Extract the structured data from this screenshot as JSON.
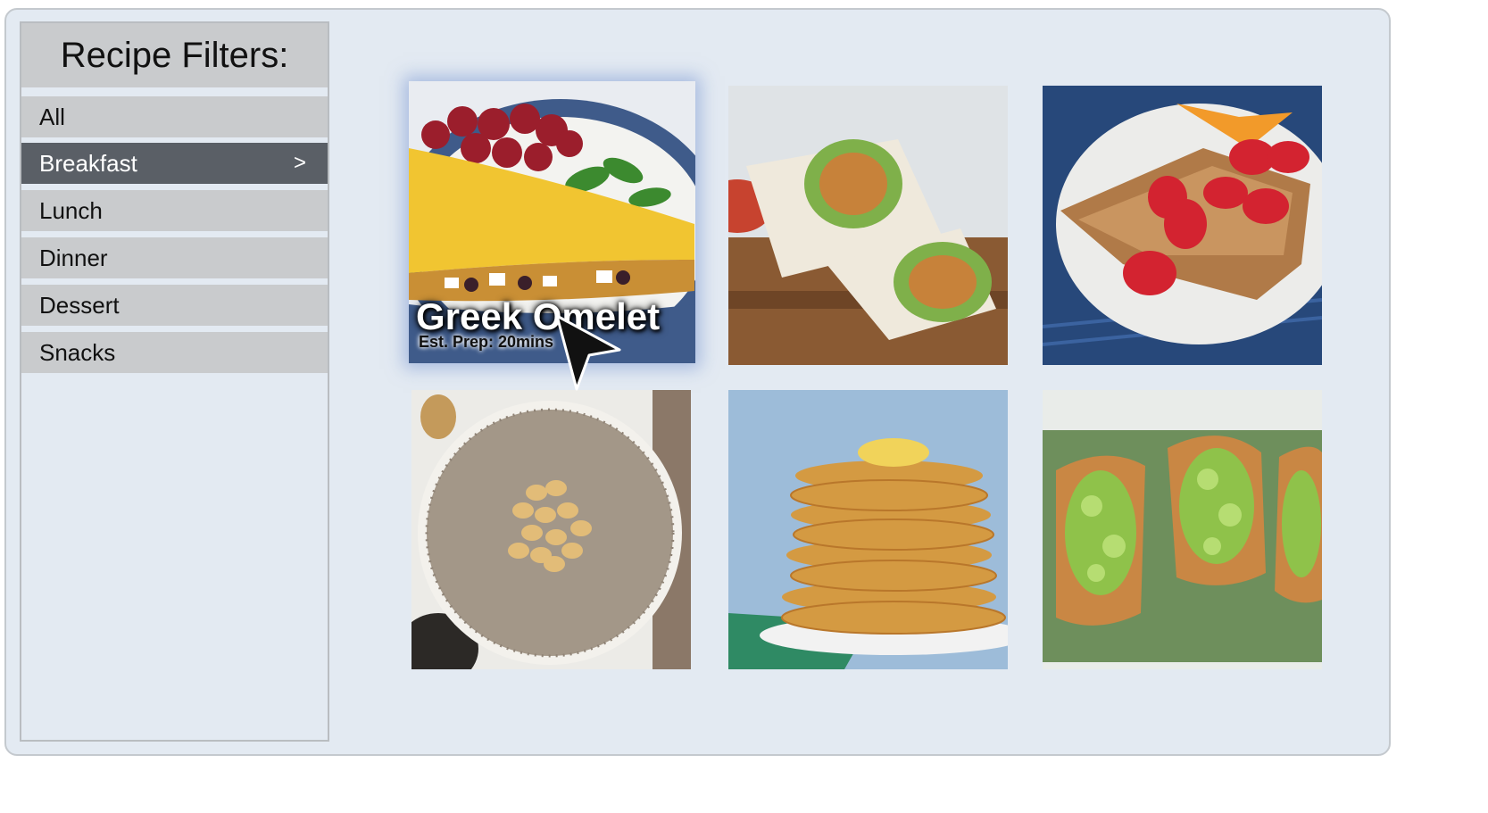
{
  "sidebar": {
    "title": "Recipe Filters:",
    "items": [
      {
        "label": "All",
        "active": false
      },
      {
        "label": "Breakfast",
        "active": true,
        "arrow": ">"
      },
      {
        "label": "Lunch",
        "active": false
      },
      {
        "label": "Dinner",
        "active": false
      },
      {
        "label": "Dessert",
        "active": false
      },
      {
        "label": "Snacks",
        "active": false
      }
    ]
  },
  "recipes": [
    {
      "image": "greek-omelet-photo",
      "title": "Greek Omelet",
      "prep": "Est. Prep: 20mins",
      "selected": true
    },
    {
      "image": "chicken-wrap-photo"
    },
    {
      "image": "french-toast-strawberries-photo"
    },
    {
      "image": "chia-oatmeal-peanuts-photo"
    },
    {
      "image": "pancake-stack-photo"
    },
    {
      "image": "avocado-toast-photo"
    }
  ],
  "colors": {
    "panel_background": "#e3eaf2",
    "filter_item": "#c9cbcd",
    "filter_active": "#5a5f66"
  },
  "cursor": {
    "icon": "mouse-pointer-icon"
  }
}
